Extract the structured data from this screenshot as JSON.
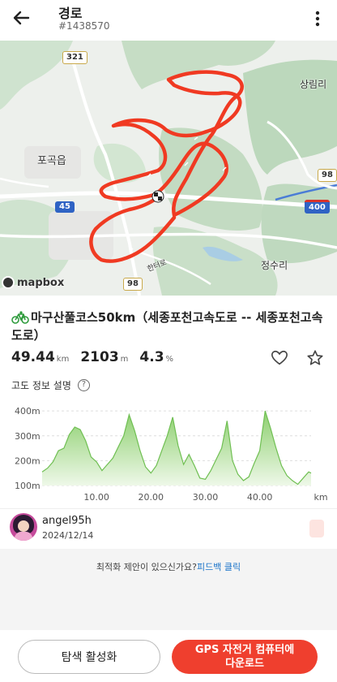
{
  "header": {
    "title": "경로",
    "route_id": "#1438570",
    "back_icon": "arrow-left-icon",
    "more_icon": "more-vertical-icon"
  },
  "map": {
    "road_badges": [
      "321",
      "98",
      "98"
    ],
    "expressway_badge": "400",
    "national_badge": "45",
    "places": [
      "포곡읍",
      "상림리",
      "정수리",
      "한터로"
    ],
    "attribution": "mapbox",
    "route_color": "#f03a22",
    "bike_icon": "bicycle-icon"
  },
  "course": {
    "name": "마구산풀코스50km（세종포천고속도로 -- 세종포천고속도로）"
  },
  "stats": {
    "distance": "49.44",
    "distance_unit": "km",
    "elevation_gain": "2103",
    "elevation_unit": "m",
    "grade": "4.3",
    "grade_unit": "%"
  },
  "elevation": {
    "heading": "고도 정보 설명",
    "help_icon": "?"
  },
  "chart_data": {
    "type": "area",
    "xlabel": "km",
    "ylabel": "",
    "y_ticks": [
      "400m",
      "300m",
      "200m",
      "100m"
    ],
    "x_ticks": [
      "10.00",
      "20.00",
      "30.00",
      "40.00"
    ],
    "xlim": [
      0,
      49.44
    ],
    "ylim": [
      100,
      420
    ],
    "color": "#8ccf6e",
    "x": [
      0,
      1,
      2,
      3,
      4,
      5,
      6,
      7,
      8,
      9,
      10,
      11,
      12,
      13,
      14,
      15,
      16,
      17,
      18,
      19,
      20,
      21,
      22,
      23,
      24,
      25,
      26,
      27,
      28,
      29,
      30,
      31,
      32,
      33,
      34,
      35,
      36,
      37,
      38,
      39,
      40,
      41,
      42,
      43,
      44,
      45,
      46,
      47,
      48,
      49,
      49.44
    ],
    "y": [
      155,
      170,
      195,
      240,
      250,
      305,
      335,
      325,
      280,
      215,
      195,
      160,
      185,
      210,
      255,
      300,
      385,
      320,
      240,
      175,
      150,
      180,
      240,
      300,
      375,
      260,
      185,
      225,
      180,
      130,
      125,
      160,
      205,
      250,
      360,
      200,
      145,
      120,
      135,
      190,
      240,
      400,
      330,
      250,
      180,
      140,
      120,
      105,
      130,
      155,
      150
    ]
  },
  "author": {
    "name": "angel95h",
    "date": "2024/12/14"
  },
  "feedback": {
    "prompt": "최적화 제안이 있으신가요?",
    "link": "피드백 클릭"
  },
  "buttons": {
    "explore": "탐색 활성화",
    "gps_line1": "GPS 자전거 컴퓨터에",
    "gps_line2": "다운로드"
  }
}
